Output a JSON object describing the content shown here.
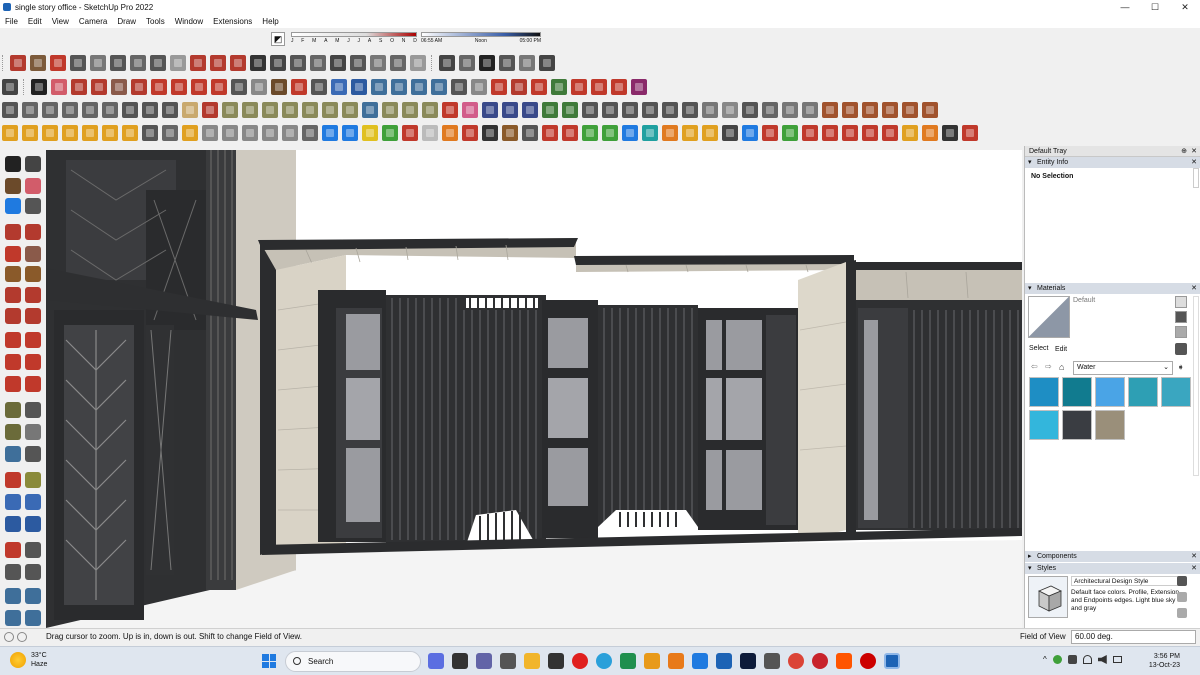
{
  "window": {
    "title": "single story office - SketchUp Pro 2022",
    "minimize_glyph": "—",
    "maximize_glyph": "☐",
    "close_glyph": "✕"
  },
  "menu": {
    "items": [
      "File",
      "Edit",
      "View",
      "Camera",
      "Draw",
      "Tools",
      "Window",
      "Extensions",
      "Help"
    ]
  },
  "shadows": {
    "months": [
      "J",
      "F",
      "M",
      "A",
      "M",
      "J",
      "J",
      "A",
      "S",
      "O",
      "N",
      "D"
    ],
    "time_start": "06:55 AM",
    "time_mid": "Noon",
    "time_end": "05:00 PM"
  },
  "tray": {
    "title": "Default Tray",
    "pin_glyph": "⊕",
    "close_glyph": "✕",
    "entity_info": {
      "header": "Entity Info",
      "value": "No Selection"
    },
    "materials": {
      "header": "Materials",
      "current_name": "Default",
      "tab_select": "Select",
      "tab_edit": "Edit",
      "library": "Water"
    },
    "components": {
      "header": "Components"
    },
    "styles": {
      "header": "Styles",
      "style_name": "Architectural Design Style",
      "style_description": "Default face colors. Profile, Extension and Endpoints edges. Light blue sky and gray"
    }
  },
  "status": {
    "message": "Drag cursor to zoom.  Up is in, down is out. Shift to change Field of View.",
    "field_label": "Field of View",
    "field_value": "60.00 deg."
  },
  "taskbar": {
    "weather_temp": "33°C",
    "weather_text": "Haze",
    "search_placeholder": "Search",
    "time": "3:56 PM",
    "date": "13-Oct-23",
    "tray_chevron": "^"
  },
  "colors": {
    "accent": "#1d63b5",
    "swatches": [
      "#1e8ec4",
      "#117b8f",
      "#4aa4e6",
      "#2e9fb4",
      "#3aa6c0",
      "#33b6dc",
      "#3a3d42",
      "#9a8f7a"
    ]
  }
}
